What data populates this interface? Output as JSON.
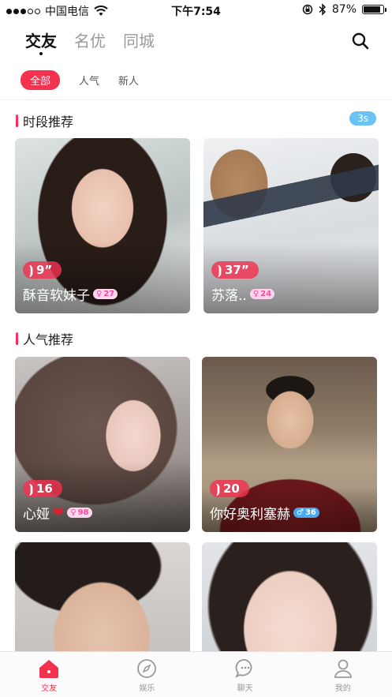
{
  "status_bar": {
    "carrier": "中国电信",
    "time": "下午7:54",
    "battery": "87%",
    "battery_level": 0.87
  },
  "top_tabs": [
    {
      "label": "交友",
      "active": true
    },
    {
      "label": "名优",
      "active": false
    },
    {
      "label": "同城",
      "active": false
    }
  ],
  "filters": [
    {
      "label": "全部",
      "active": true
    },
    {
      "label": "人气",
      "active": false
    },
    {
      "label": "新人",
      "active": false
    }
  ],
  "sections": {
    "time_slot": {
      "title": "时段推荐",
      "badge": "3s"
    },
    "popular": {
      "title": "人气推荐"
    }
  },
  "cards": [
    {
      "name": "酥音软妹子",
      "voice": "9”",
      "count": "27",
      "count_style": "pink",
      "icon": "female-symbol"
    },
    {
      "name": "苏落..",
      "voice": "37”",
      "count": "24",
      "count_style": "pink",
      "icon": "female-symbol"
    },
    {
      "name": "心娅",
      "voice": "16",
      "count": "98",
      "count_style": "pink",
      "icon": "female-symbol"
    },
    {
      "name": "你好奥利塞赫",
      "voice": "20",
      "count": "36",
      "count_style": "blue",
      "icon": "male-symbol"
    }
  ],
  "bottom_nav": [
    {
      "label": "交友",
      "icon": "home-icon",
      "active": true
    },
    {
      "label": "娱乐",
      "icon": "compass-icon",
      "active": false
    },
    {
      "label": "聊天",
      "icon": "chat-icon",
      "active": false
    },
    {
      "label": "我的",
      "icon": "profile-icon",
      "active": false
    }
  ],
  "colors": {
    "accent": "#f2324f",
    "badge_blue": "#69c3f4"
  }
}
